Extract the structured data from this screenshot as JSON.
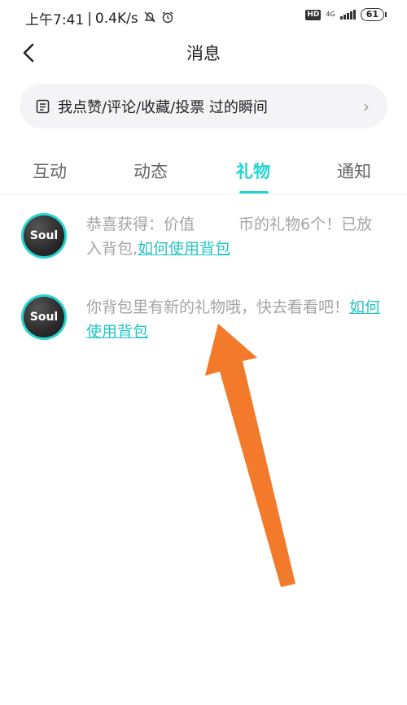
{
  "status_bar": {
    "time": "上午7:41",
    "speed": "0.4K/s",
    "hd": "HD",
    "network": "4G",
    "battery": "61"
  },
  "header": {
    "title": "消息"
  },
  "banner": {
    "text": "我点赞/评论/收藏/投票 过的瞬间"
  },
  "tabs": [
    {
      "label": "互动"
    },
    {
      "label": "动态"
    },
    {
      "label": "礼物"
    },
    {
      "label": "通知"
    }
  ],
  "active_tab": "礼物",
  "messages": [
    {
      "avatar_text": "Soul",
      "text_before": "恭喜获得：价值",
      "text_after": "币的礼物6个！已放入背包,",
      "link": "如何使用背包"
    },
    {
      "avatar_text": "Soul",
      "text": "你背包里有新的礼物哦，快去看看吧！",
      "link": "如何使用背包"
    }
  ],
  "colors": {
    "accent": "#25d4d0",
    "link": "#25c6c2",
    "annotation_arrow": "#f27a2a"
  }
}
